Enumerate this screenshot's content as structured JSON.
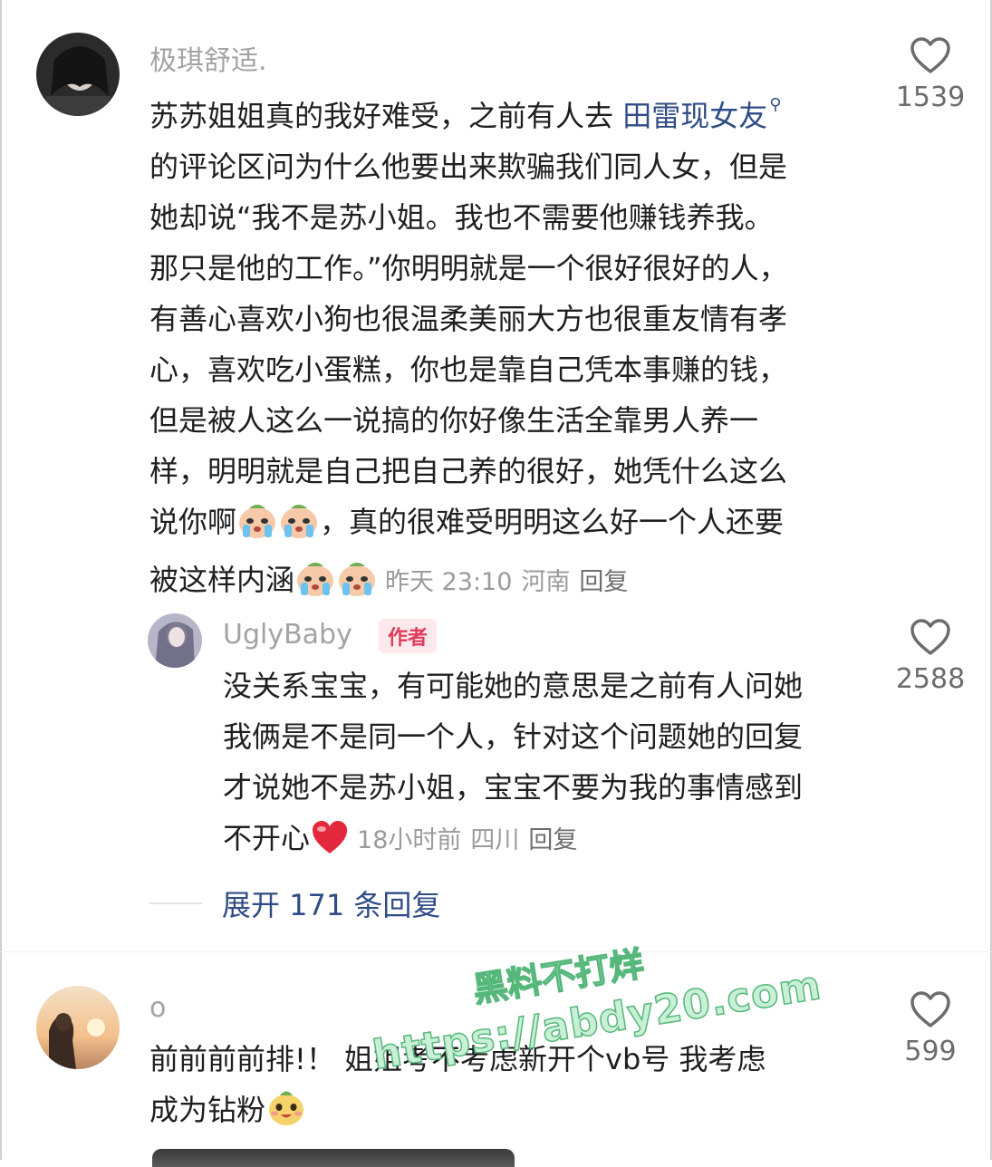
{
  "comments": [
    {
      "username": "极琪舒适.",
      "lines": [
        "苏苏姐姐真的我好难受，之前有人去",
        "的评论区问为什么他要出来欺骗我们同人女，但是",
        "她却说“我不是苏小姐。我也不需要他赚钱养我。",
        "那只是他的工作。”你明明就是一个很好很好的人，",
        "有善心喜欢小狗也很温柔美丽大方也很重友情有孝",
        "心，喜欢吃小蛋糕，你也是靠自己凭本事赚的钱，",
        "但是被人这么一说搞的你好像生活全靠男人养一",
        "样，明明就是自己把自己养的很好，她凭什么这么",
        "说你啊",
        "，真的很难受明明这么好一个人还要",
        "被这样内涵"
      ],
      "mention": "田雷现女友",
      "meta": {
        "time": "昨天 23:10",
        "location": "河南",
        "reply": "回复"
      },
      "likes": "1539"
    },
    {
      "username": "UglyBaby",
      "author_tag": "作者",
      "lines": [
        "没关系宝宝，有可能她的意思是之前有人问她",
        "我俩是不是同一个人，针对这个问题她的回复",
        "才说她不是苏小姐，宝宝不要为我的事情感到",
        "不开心"
      ],
      "meta": {
        "time": "18小时前",
        "location": "四川",
        "reply": "回复"
      },
      "likes": "2588"
    },
    {
      "username": "o",
      "lines": [
        "前前前前排!！ 姐姐考不考虑新开个vb号  我考虑",
        "成为钻粉"
      ],
      "likes": "599"
    }
  ],
  "expand_replies": "展开 171 条回复",
  "watermark": {
    "line1": "黑料不打烊",
    "line2": "https://abdy20.com"
  },
  "colors": {
    "link": "#304c86",
    "author_tag_bg": "#fbe9ec",
    "author_tag_text": "#e23b5b",
    "meta": "#9b9b9b"
  }
}
